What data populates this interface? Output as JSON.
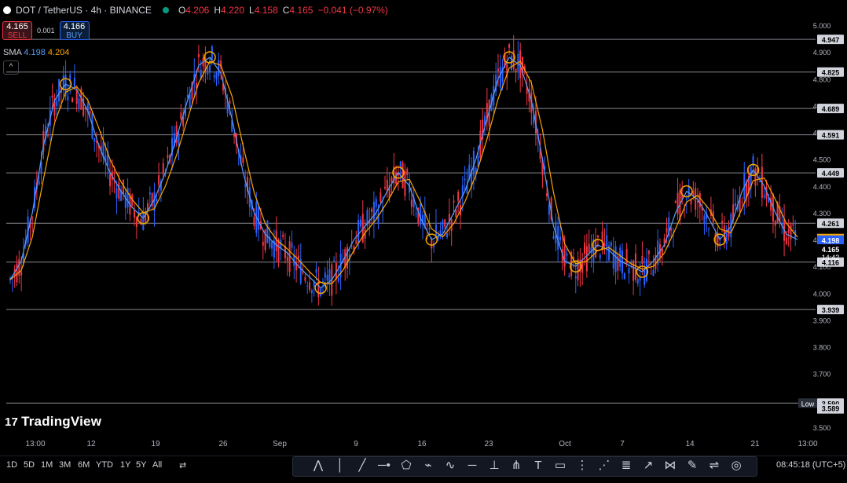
{
  "header": {
    "symbol": "DOT / TetherUS · 4h · BINANCE",
    "open_label": "O",
    "open": "4.206",
    "high_label": "H",
    "high": "4.220",
    "low_label": "L",
    "low": "4.158",
    "close_label": "C",
    "close": "4.165",
    "change": "−0.041 (−0.97%)"
  },
  "trade": {
    "sell_price": "4.165",
    "sell_label": "SELL",
    "spread": "0.001",
    "buy_price": "4.166",
    "buy_label": "BUY"
  },
  "indicator": {
    "name": "SMA",
    "value1": "4.198",
    "value2": "4.204"
  },
  "colors": {
    "up": "#2962ff",
    "down": "#f23645",
    "sma_fast": "#5b9cf6",
    "sma_slow": "#f7a600",
    "marker": "#f7a600",
    "hline": "#b2b5be"
  },
  "logo_text": "TradingView",
  "price_axis_ticks": [
    "5.000",
    "4.900",
    "4.800",
    "4.700",
    "4.600",
    "4.500",
    "4.400",
    "4.300",
    "4.200",
    "4.100",
    "4.000",
    "3.900",
    "3.800",
    "3.700",
    "3.600",
    "3.500"
  ],
  "horizontal_levels": [
    "4.947",
    "4.825",
    "4.689",
    "4.591",
    "4.449",
    "4.261",
    "4.116",
    "3.939",
    "3.590"
  ],
  "low_label": "Low",
  "low_value": "3.589",
  "price_tags": {
    "sma_slow": "4.204",
    "sma_fast": "4.198",
    "last": "4.165",
    "countdown": "14:42"
  },
  "time_axis_labels": [
    "13:00",
    "12",
    "19",
    "26",
    "Sep",
    "9",
    "16",
    "23",
    "Oct",
    "7",
    "14",
    "21",
    "13:00"
  ],
  "timeframes": [
    "1D",
    "5D",
    "1M",
    "3M",
    "6M",
    "YTD",
    "1Y",
    "5Y",
    "All"
  ],
  "drawing_tools": [
    "pattern-icon",
    "vertical-line-icon",
    "trendline-icon",
    "horizontal-ray-icon",
    "path-icon",
    "polyline-icon",
    "curve-icon",
    "horizontal-line-icon",
    "fib-icon",
    "pitchfork-icon",
    "text-icon",
    "rectangle-icon",
    "gann-icon",
    "zigzag-icon",
    "fib-retracement-icon",
    "trend-angle-icon",
    "xabcd-icon",
    "brush-icon",
    "parallel-channel-icon",
    "circle-icon"
  ],
  "clock": "08:45:18 (UTC+5)",
  "chart_data": {
    "type": "candlestick",
    "y_range": [
      3.5,
      5.05
    ],
    "series": [
      {
        "name": "SMA",
        "values": [
          4.05,
          4.12,
          4.3,
          4.55,
          4.72,
          4.78,
          4.76,
          4.68,
          4.55,
          4.45,
          4.38,
          4.32,
          4.28,
          4.35,
          4.45,
          4.58,
          4.72,
          4.85,
          4.88,
          4.82,
          4.65,
          4.45,
          4.3,
          4.22,
          4.18,
          4.15,
          4.1,
          4.06,
          4.02,
          4.05,
          4.12,
          4.2,
          4.25,
          4.3,
          4.38,
          4.45,
          4.4,
          4.28,
          4.2,
          4.22,
          4.3,
          4.38,
          4.5,
          4.65,
          4.8,
          4.88,
          4.85,
          4.72,
          4.5,
          4.25,
          4.12,
          4.1,
          4.14,
          4.18,
          4.16,
          4.12,
          4.1,
          4.08,
          4.12,
          4.18,
          4.3,
          4.38,
          4.35,
          4.28,
          4.2,
          4.25,
          4.38,
          4.46,
          4.4,
          4.3,
          4.22,
          4.2
        ]
      }
    ]
  }
}
